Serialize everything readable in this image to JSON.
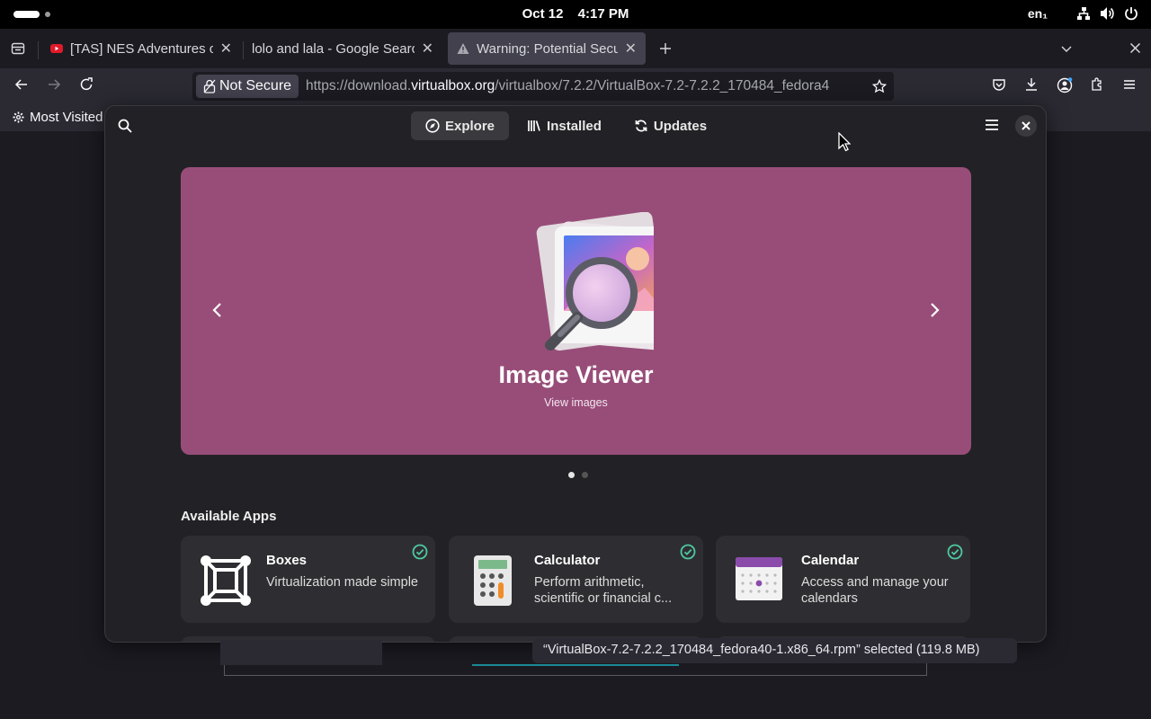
{
  "topbar": {
    "date": "Oct 12",
    "time": "4:17 PM",
    "input_language": "en₁",
    "icons": [
      "network-icon",
      "volume-icon",
      "power-icon"
    ]
  },
  "browser": {
    "tabs": [
      {
        "title": "[TAS] NES Adventures o",
        "icon": "youtube-icon",
        "active": false
      },
      {
        "title": "lolo and lala - Google Searc",
        "icon": "google-icon",
        "active": false
      },
      {
        "title": "Warning: Potential Secu",
        "icon": "warning-icon",
        "active": true
      }
    ],
    "security_label": "Not Secure",
    "url_prefix": "https://download.",
    "url_domain": "virtualbox.org",
    "url_rest": "/virtualbox/7.2.2/VirtualBox-7.2-7.2.2_170484_fedora4",
    "bookmark": "Most Visited",
    "download_toast": "“VirtualBox-7.2-7.2.2_170484_fedora40-1.x86_64.rpm” selected  (119.8 MB)"
  },
  "software": {
    "tabs": [
      {
        "label": "Explore",
        "icon": "compass-icon",
        "selected": true
      },
      {
        "label": "Installed",
        "icon": "library-icon",
        "selected": false
      },
      {
        "label": "Updates",
        "icon": "refresh-icon",
        "selected": false
      }
    ],
    "banner": {
      "title": "Image Viewer",
      "subtitle": "View images",
      "color": "#984d79",
      "page_count": 2,
      "current_page": 1
    },
    "section_title": "Available Apps",
    "apps": [
      {
        "name": "Boxes",
        "description": "Virtualization made simple",
        "icon": "boxes-icon",
        "installed": true
      },
      {
        "name": "Calculator",
        "description": "Perform arithmetic, scientific or financial c...",
        "icon": "calculator-icon",
        "installed": true
      },
      {
        "name": "Calendar",
        "description": "Access and manage your calendars",
        "icon": "calendar-icon",
        "installed": true
      }
    ]
  },
  "colors": {
    "accent_check": "#4ec9a0",
    "dialog_bg": "#222226",
    "card_bg": "#2e2e32"
  }
}
